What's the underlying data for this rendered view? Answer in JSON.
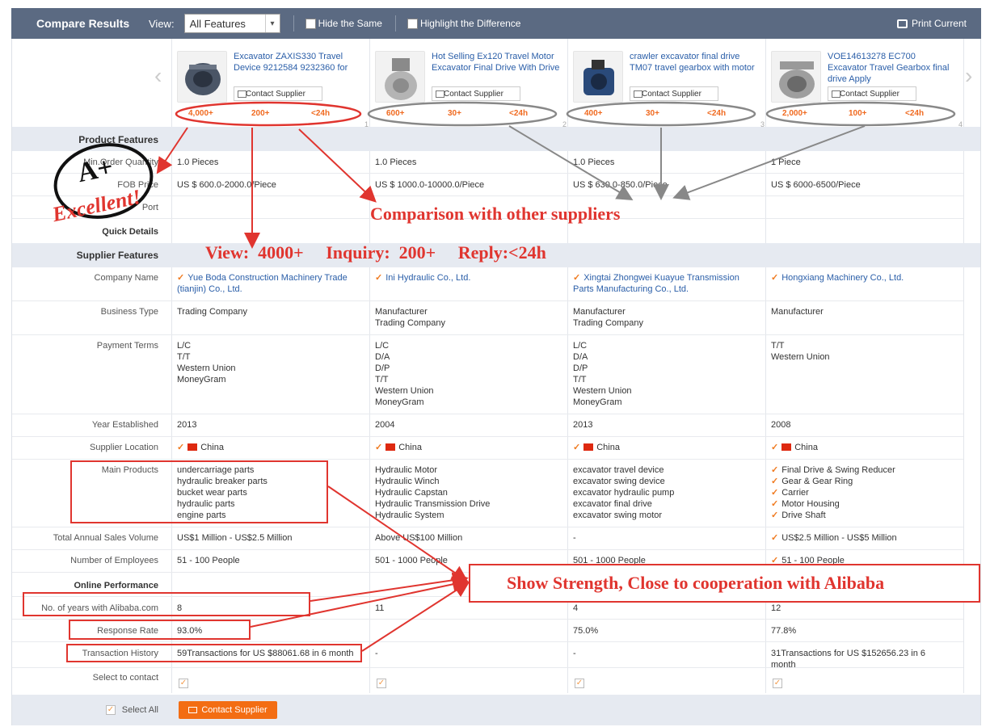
{
  "toolbar": {
    "title": "Compare Results",
    "view_label": "View:",
    "view_value": "All Features",
    "hide_same": "Hide the Same",
    "highlight_diff": "Highlight the Difference",
    "print": "Print Current"
  },
  "products": [
    {
      "title": "Excavator ZAXIS330 Travel Device 9212584 9232360 for",
      "contact": "Contact Supplier",
      "views": "4,000+",
      "inquiries": "200+",
      "reply": "<24h",
      "num": "1"
    },
    {
      "title": "Hot Selling Ex120 Travel Motor Excavator Final Drive With Drive",
      "contact": "Contact Supplier",
      "views": "600+",
      "inquiries": "30+",
      "reply": "<24h",
      "num": "2"
    },
    {
      "title": "crawler excavator final drive TM07 travel gearbox with motor",
      "contact": "Contact Supplier",
      "views": "400+",
      "inquiries": "30+",
      "reply": "<24h",
      "num": "3"
    },
    {
      "title": "VOE14613278 EC700 Excavator Travel Gearbox final drive Apply",
      "contact": "Contact Supplier",
      "views": "2,000+",
      "inquiries": "100+",
      "reply": "<24h",
      "num": "4"
    }
  ],
  "sections": {
    "product": "Product Features",
    "supplier": "Supplier Features",
    "online": "Online Performance"
  },
  "labels": {
    "moq": "Min.Order Quantity",
    "fob": "FOB Price",
    "port": "Port",
    "quick": "Quick Details",
    "company": "Company Name",
    "btype": "Business Type",
    "payment": "Payment Terms",
    "year": "Year Established",
    "location": "Supplier Location",
    "main": "Main Products",
    "sales": "Total Annual Sales Volume",
    "employees": "Number of Employees",
    "years_ali": "No. of years with Alibaba.com",
    "response": "Response Rate",
    "transactions": "Transaction History",
    "select": "Select to contact",
    "select_all": "Select All",
    "contact_btn": "Contact Supplier"
  },
  "rows": {
    "moq": [
      "1.0 Pieces",
      "1.0 Pieces",
      "1.0 Pieces",
      "1 Piece"
    ],
    "fob": [
      "US $ 600.0-2000.0/Piece",
      "US $ 1000.0-10000.0/Piece",
      "US $ 630.0-850.0/Piece",
      "US $ 6000-6500/Piece"
    ],
    "company": [
      "Yue Boda Construction Machinery Trade (tianjin) Co., Ltd.",
      "Ini Hydraulic Co., Ltd.",
      "Xingtai Zhongwei Kuayue Transmission Parts Manufacturing Co., Ltd.",
      "Hongxiang Machinery Co., Ltd."
    ],
    "btype": [
      [
        "Trading Company"
      ],
      [
        "Manufacturer",
        "Trading Company"
      ],
      [
        "Manufacturer",
        "Trading Company"
      ],
      [
        "Manufacturer"
      ]
    ],
    "payment": [
      [
        "L/C",
        "T/T",
        "Western Union",
        "MoneyGram"
      ],
      [
        "L/C",
        "D/A",
        "D/P",
        "T/T",
        "Western Union",
        "MoneyGram"
      ],
      [
        "L/C",
        "D/A",
        "D/P",
        "T/T",
        "Western Union",
        "MoneyGram"
      ],
      [
        "T/T",
        "Western Union"
      ]
    ],
    "year": [
      "2013",
      "2004",
      "2013",
      "2008"
    ],
    "location": [
      "China",
      "China",
      "China",
      "China"
    ],
    "main": [
      [
        "undercarriage parts",
        "hydraulic breaker parts",
        "bucket wear parts",
        "hydraulic parts",
        "engine parts"
      ],
      [
        "Hydraulic Motor",
        "Hydraulic Winch",
        "Hydraulic Capstan",
        "Hydraulic Transmission Drive",
        "Hydraulic System"
      ],
      [
        "excavator travel device",
        "excavator swing device",
        "excavator hydraulic pump",
        "excavator final drive",
        "excavator swing motor"
      ],
      [
        "Final Drive & Swing Reducer",
        "Gear & Gear Ring",
        "Carrier",
        "Motor Housing",
        "Drive Shaft"
      ]
    ],
    "sales": [
      "US$1 Million - US$2.5 Million",
      "Above US$100 Million",
      "-",
      "US$2.5 Million - US$5 Million"
    ],
    "employees": [
      "51 - 100 People",
      "501 - 1000 People",
      "501 - 1000 People",
      "51 - 100 People"
    ],
    "years_ali": [
      "8",
      "11",
      "4",
      "12"
    ],
    "response": [
      "93.0%",
      "",
      "75.0%",
      "77.8%"
    ],
    "transactions": [
      "59Transactions for US $88061.68 in 6 month",
      "-",
      "-",
      "31Transactions for US $152656.23 in 6 month"
    ]
  },
  "annotations": {
    "grade": "A+",
    "excellent": "Excellent!",
    "compare": "Comparison with other suppliers",
    "view_line": "View:  4000+     Inquiry:  200+     Reply:<24h",
    "strength": "Show Strength,  Close to cooperation with Alibaba"
  },
  "colors": {
    "header": "#5b6a82",
    "band": "#e6eaf1",
    "accent": "#f36d13",
    "annotation": "#e0352f",
    "link": "#2a5ea8"
  }
}
